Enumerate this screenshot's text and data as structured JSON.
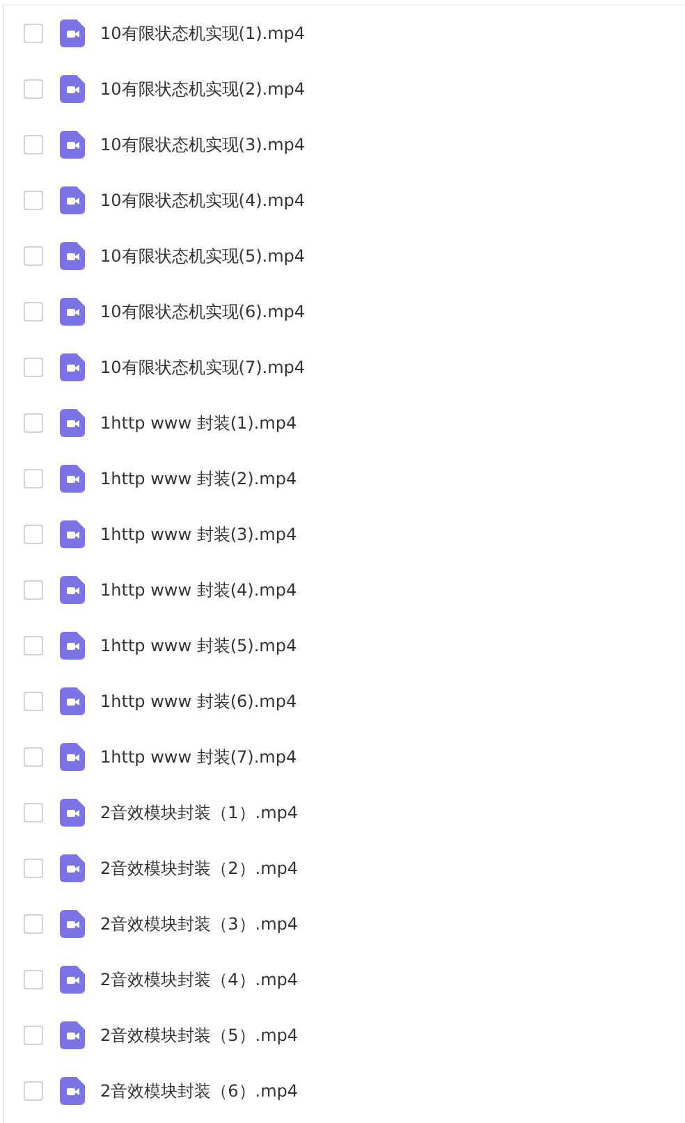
{
  "files": [
    {
      "name": "10有限状态机实现(1).mp4",
      "checked": false
    },
    {
      "name": "10有限状态机实现(2).mp4",
      "checked": false
    },
    {
      "name": "10有限状态机实现(3).mp4",
      "checked": false
    },
    {
      "name": "10有限状态机实现(4).mp4",
      "checked": false
    },
    {
      "name": "10有限状态机实现(5).mp4",
      "checked": false
    },
    {
      "name": "10有限状态机实现(6).mp4",
      "checked": false
    },
    {
      "name": "10有限状态机实现(7).mp4",
      "checked": false
    },
    {
      "name": "1http www 封装(1).mp4",
      "checked": false
    },
    {
      "name": "1http www 封装(2).mp4",
      "checked": false
    },
    {
      "name": "1http www 封装(3).mp4",
      "checked": false
    },
    {
      "name": "1http www 封装(4).mp4",
      "checked": false
    },
    {
      "name": "1http www 封装(5).mp4",
      "checked": false
    },
    {
      "name": "1http www 封装(6).mp4",
      "checked": false
    },
    {
      "name": "1http www 封装(7).mp4",
      "checked": false
    },
    {
      "name": "2音效模块封装（1）.mp4",
      "checked": false
    },
    {
      "name": "2音效模块封装（2）.mp4",
      "checked": false
    },
    {
      "name": "2音效模块封装（3）.mp4",
      "checked": false
    },
    {
      "name": "2音效模块封装（4）.mp4",
      "checked": false
    },
    {
      "name": "2音效模块封装（5）.mp4",
      "checked": false
    },
    {
      "name": "2音效模块封装（6）.mp4",
      "checked": false
    }
  ]
}
